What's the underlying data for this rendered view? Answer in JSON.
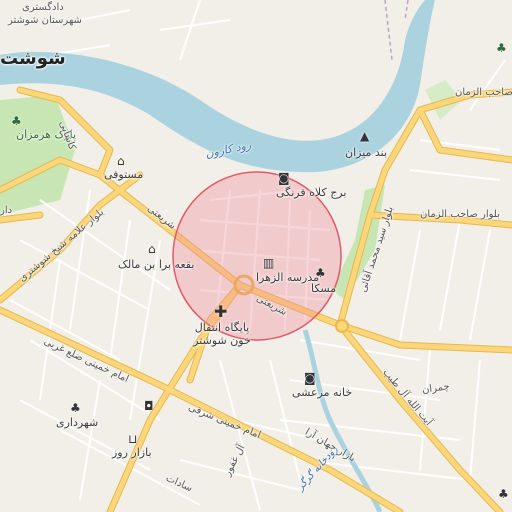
{
  "map": {
    "city_label": "شوشتر",
    "city_label_partial": "شوشت",
    "river_label": "رود کارون",
    "river_label_2": "رودخانه گرگر",
    "places": [
      {
        "key": "dadgostari",
        "label": "دادگستری"
      },
      {
        "key": "shahrestan",
        "label": "شهرستان شوشتر"
      },
      {
        "key": "park_harmozan",
        "label": "پارک هرمزان"
      },
      {
        "key": "bond_mizan",
        "label": "بند میزان"
      },
      {
        "key": "borj_kolah_farangi",
        "label": "برج کلاه فرنگی"
      },
      {
        "key": "mostowfi",
        "label": "مستوفی"
      },
      {
        "key": "boghe",
        "label": "بقعه برا بن مالک"
      },
      {
        "key": "madrese",
        "label": "مدرسه الزهرا"
      },
      {
        "key": "maska",
        "label": "مسکا"
      },
      {
        "key": "paygah",
        "label": "پایگاه انتقال خون شوشتر"
      },
      {
        "key": "khane_marashi",
        "label": "خانه مرعشی"
      },
      {
        "key": "shahrdari",
        "label": "شهرداری"
      },
      {
        "key": "bazar_rooz",
        "label": "بازار روز"
      }
    ],
    "streets": [
      {
        "key": "sahebzaman_top",
        "label": "صاحب الزمان"
      },
      {
        "key": "blvd_sahebzaman",
        "label": "بلوار صاحب الزمان"
      },
      {
        "key": "blvd_sardar",
        "label": "بلوار سید محمد آقائی"
      },
      {
        "key": "ayatollah",
        "label": "آیت الله آل طیب"
      },
      {
        "key": "chamran",
        "label": "چمران"
      },
      {
        "key": "imam_khomeini_gharbi",
        "label": "امام خمینی ضلع غربی"
      },
      {
        "key": "imam_khomeini_sharghi",
        "label": "امام خمینی شرقی"
      },
      {
        "key": "blvd_allameh",
        "label": "بلوار علامه شیخ شوشتری"
      },
      {
        "key": "kashani",
        "label": "کاشانی"
      },
      {
        "key": "shariati",
        "label": "شریعتی"
      },
      {
        "key": "bazarjahan",
        "label": "بازار جهان آرا"
      },
      {
        "key": "sadat",
        "label": "سادات"
      },
      {
        "key": "al_ghafour",
        "label": "آل غفور"
      }
    ],
    "colors": {
      "land": "#f2efe9",
      "water": "#aad3df",
      "major_road": "#fcd67a",
      "road_casing": "#e6b84d",
      "green": "#c8e6b4",
      "circle_fill": "#f08a96",
      "circle_stroke": "#e05a6a"
    }
  }
}
